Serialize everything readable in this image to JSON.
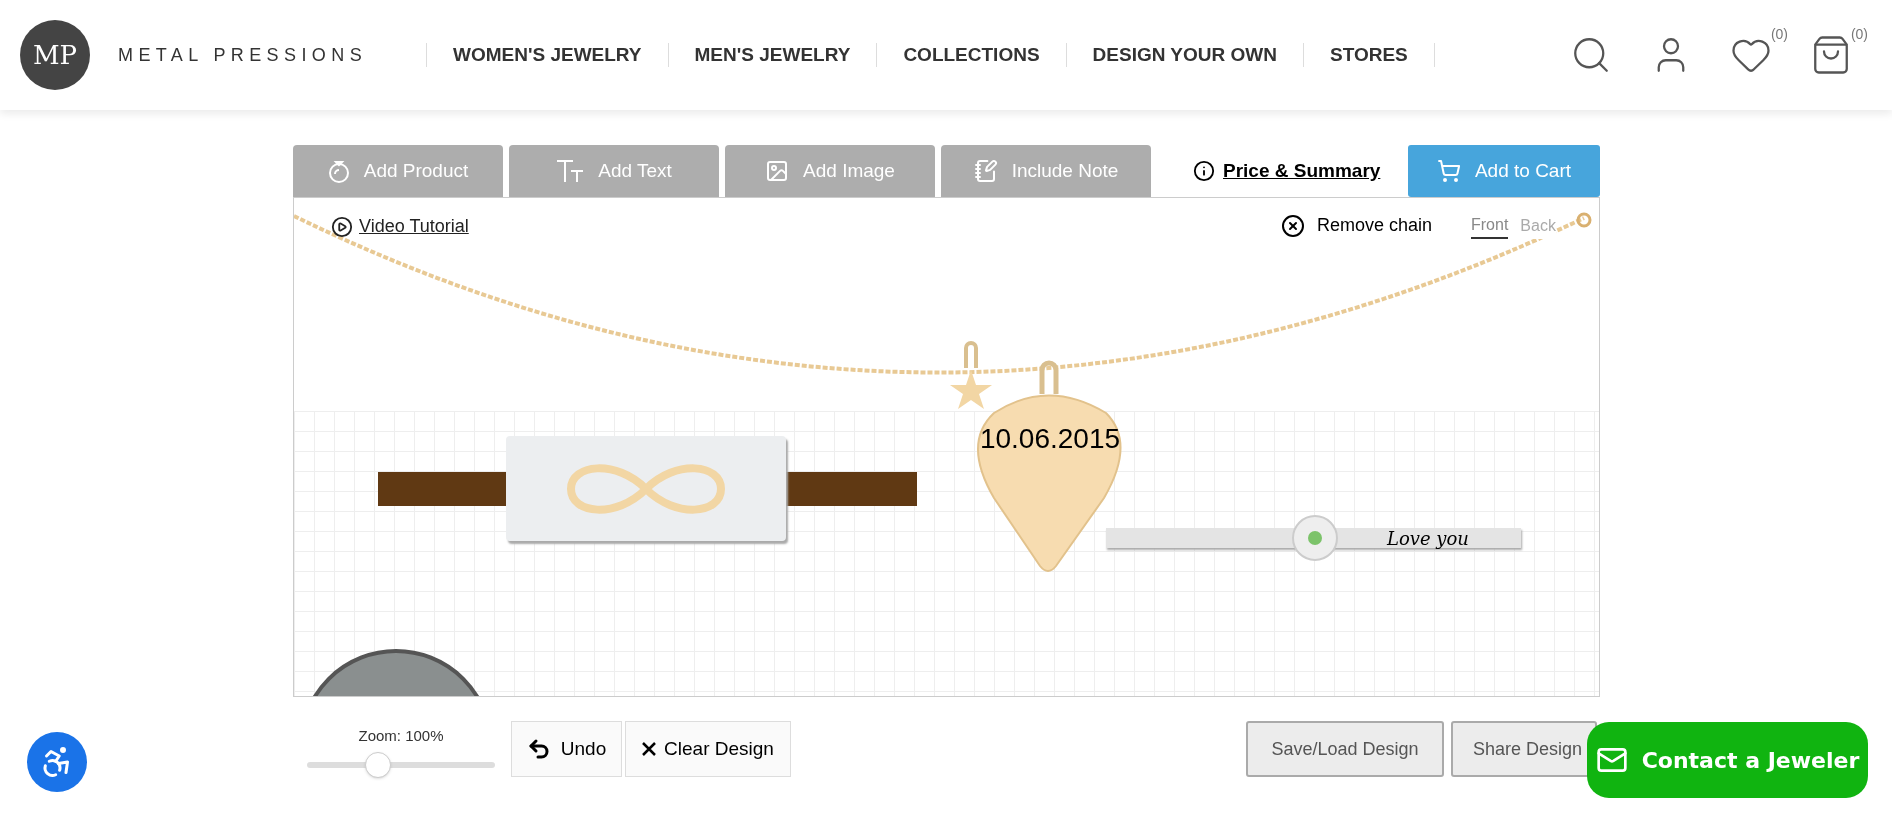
{
  "header": {
    "logo_text": "MP",
    "brand": "METAL PRESSIONS",
    "nav": [
      "WOMEN'S JEWELRY",
      "MEN'S JEWELRY",
      "COLLECTIONS",
      "DESIGN YOUR OWN",
      "STORES"
    ],
    "wishlist_count": "(0)",
    "cart_count": "(0)"
  },
  "toolbar": {
    "tools": [
      {
        "kind": "product",
        "label": "Add Product"
      },
      {
        "kind": "text",
        "label": "Add Text"
      },
      {
        "kind": "image",
        "label": "Add Image"
      },
      {
        "kind": "note",
        "label": "Include Note"
      }
    ],
    "summary_link": "Price & Summary",
    "add_to_cart": "Add to Cart"
  },
  "canvas": {
    "video_tutorial": "Video Tutorial",
    "remove_chain": "Remove chain",
    "sides": [
      {
        "label": "Front",
        "selected": true
      },
      {
        "label": "Back",
        "selected": false
      }
    ],
    "pick_engraving": "10.06.2015",
    "bar_engraving": "Love you"
  },
  "bottom": {
    "zoom_label": "Zoom: 100%",
    "zoom": {
      "level": 0.38
    },
    "undo": "Undo",
    "clear": "Clear Design",
    "save_load": "Save/Load Design",
    "share": "Share Design",
    "contact": "Contact a Jeweler"
  }
}
